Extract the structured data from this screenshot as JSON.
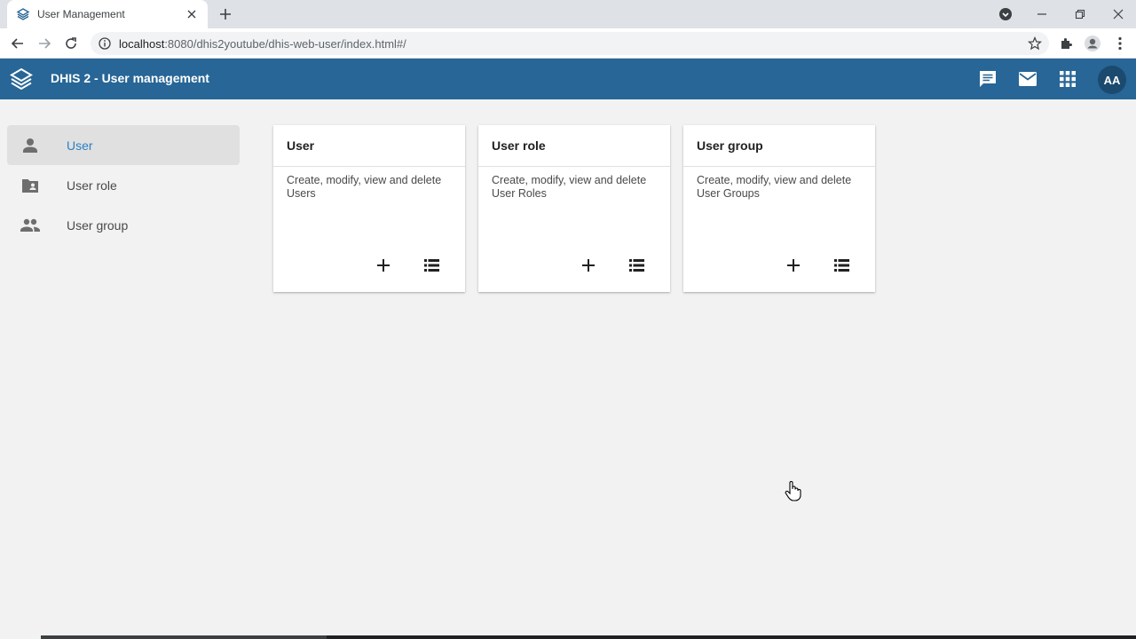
{
  "browser": {
    "tab": {
      "title": "User Management"
    },
    "url": {
      "host": "localhost",
      "rest": ":8080/dhis2youtube/dhis-web-user/index.html#/"
    }
  },
  "header": {
    "title": "DHIS 2 - User management",
    "avatar_initials": "AA"
  },
  "sidebar": {
    "items": [
      {
        "label": "User",
        "icon": "person-icon",
        "active": true
      },
      {
        "label": "User role",
        "icon": "folder-shared-icon",
        "active": false
      },
      {
        "label": "User group",
        "icon": "group-icon",
        "active": false
      }
    ]
  },
  "cards": [
    {
      "title": "User",
      "description": "Create, modify, view and delete Users"
    },
    {
      "title": "User role",
      "description": "Create, modify, view and delete User Roles"
    },
    {
      "title": "User group",
      "description": "Create, modify, view and delete User Groups"
    }
  ],
  "colors": {
    "header_bg": "#276696",
    "active_link": "#2b7fc3",
    "page_bg": "#f2f2f2"
  }
}
